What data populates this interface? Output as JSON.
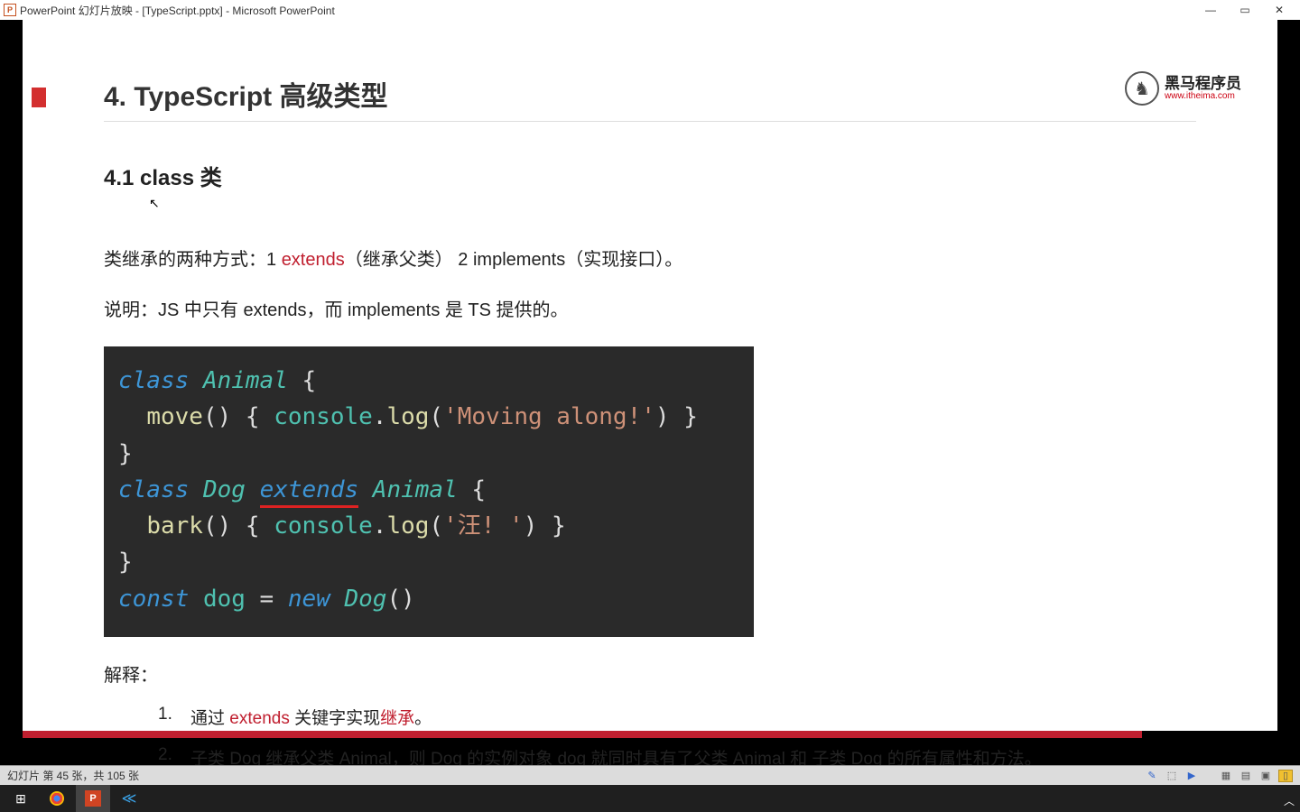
{
  "titlebar": {
    "text": "PowerPoint 幻灯片放映 - [TypeScript.pptx] - Microsoft PowerPoint",
    "minimize": "—",
    "maximize": "▭",
    "close": "✕"
  },
  "logo": {
    "brand": "黑马程序员",
    "url": "www.itheima.com"
  },
  "slide": {
    "title": "4. TypeScript 高级类型",
    "subtitle": "4.1 class 类",
    "p1_a": "类继承的两种方式：1 ",
    "p1_b": "extends",
    "p1_c": "（继承父类） 2 implements（实现接口）。",
    "p2": "说明：JS 中只有 extends，而 implements 是 TS 提供的。",
    "explain_head": "解释：",
    "li1_num": "1.",
    "li1_a": "通过 ",
    "li1_b": "extends",
    "li1_c": " 关键字实现",
    "li1_d": "继承",
    "li1_e": "。",
    "li2_num": "2.",
    "li2": "子类 Dog 继承父类 Animal，则 Dog 的实例对象 dog 就同时具有了父类 Animal 和 子类 Dog 的所有属性和方法。"
  },
  "code": {
    "kw_class1": "class",
    "name_animal": "Animal",
    "brace1": " {",
    "fn_move": "move",
    "paren1": "() { ",
    "con1": "console",
    "dot1": ".",
    "log1": "log",
    "paren2": "(",
    "str1": "'Moving along!'",
    "paren3": ") }",
    "brace2": "}",
    "kw_class2": "class",
    "name_dog": "Dog",
    "kw_ext": "extends",
    "name_animal2": "Animal",
    "brace3": " {",
    "fn_bark": "bark",
    "paren4": "() { ",
    "con2": "console",
    "dot2": ".",
    "log2": "log",
    "paren5": "(",
    "str2": "'汪! '",
    "paren6": ") }",
    "brace4": "}",
    "kw_const": "const",
    "v_dog": "dog",
    "eq": " = ",
    "kw_new": "new",
    "name_dog2": "Dog",
    "paren7": "()"
  },
  "statusbar": {
    "text": "幻灯片 第 45 张，共 105 张"
  },
  "taskbar": {
    "start": "⊞",
    "chrome": "◯",
    "ppt": "P",
    "vscode": "⟨⟩"
  }
}
